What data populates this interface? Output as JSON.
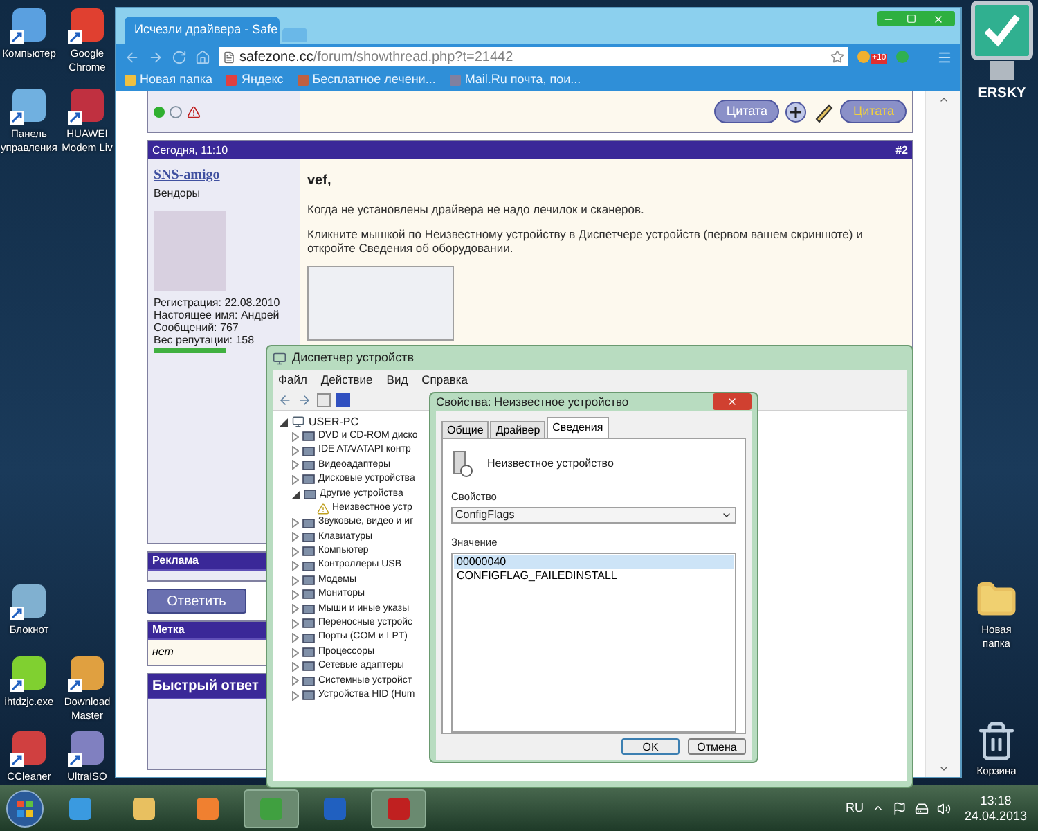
{
  "desktop_left": [
    {
      "label": "Компьютер"
    },
    {
      "label": "Google Chrome"
    },
    {
      "label": "Панель управления"
    },
    {
      "label": "HUAWEI Modem Liv"
    },
    {
      "label": "Блокнот"
    },
    {
      "label": "ihtdzjc.exe"
    },
    {
      "label": "Download Master"
    },
    {
      "label": "CCleaner"
    },
    {
      "label": "UltraISO"
    }
  ],
  "desktop_right": [
    {
      "label": "Новая папка"
    },
    {
      "label": "Корзина"
    }
  ],
  "gadget": {
    "label": "ERSKY"
  },
  "browser": {
    "tab_title": "Исчезли драйвера - Safe",
    "url_host": "safezone.cc",
    "url_path": "/forum/showthread.php?t=21442",
    "extension_badge": "+10",
    "bookmarks": [
      "Новая папка",
      "Яндекс",
      "Бесплатное лечени...",
      "Mail.Ru почта, пои..."
    ]
  },
  "forum": {
    "quote_buttons": [
      "Цитата",
      "Цитата"
    ],
    "post": {
      "date": "Сегодня, 11:10",
      "number": "#2",
      "user": "SNS-amigo",
      "role": "Вендоры",
      "stats": [
        "Регистрация: 22.08.2010",
        "Настоящее имя: Андрей",
        "Сообщений: 767",
        "Вес репутации: 158"
      ],
      "greeting": "vef,",
      "paragraphs": [
        "Когда не установлены драйвера не надо лечилок и сканеров.",
        "Кликните мышкой по Неизвестному устройству в Диспетчере устройств (первом вашем скриншоте) и откройте Сведения об оборудовании."
      ]
    },
    "ads_title": "Реклама",
    "reply_button": "Ответить",
    "tag_title": "Метка",
    "tag_value": "нет",
    "quick_reply_title": "Быстрый ответ"
  },
  "device_manager": {
    "title": "Диспетчер устройств",
    "menu": [
      "Файл",
      "Действие",
      "Вид",
      "Справка"
    ],
    "tree": {
      "label": "USER-PC",
      "expanded": true,
      "children": [
        {
          "label": "DVD и CD-ROM диско",
          "expanded": false
        },
        {
          "label": "IDE ATA/ATAPI контр",
          "expanded": false
        },
        {
          "label": "Видеоадаптеры",
          "expanded": false
        },
        {
          "label": "Дисковые устройства",
          "expanded": false
        },
        {
          "label": "Другие устройства",
          "expanded": true,
          "children": [
            {
              "label": "Неизвестное устр"
            }
          ]
        },
        {
          "label": "Звуковые, видео и иг",
          "expanded": false
        },
        {
          "label": "Клавиатуры",
          "expanded": false
        },
        {
          "label": "Компьютер",
          "expanded": false
        },
        {
          "label": "Контроллеры USB",
          "expanded": false
        },
        {
          "label": "Модемы",
          "expanded": false
        },
        {
          "label": "Мониторы",
          "expanded": false
        },
        {
          "label": "Мыши и иные указы",
          "expanded": false
        },
        {
          "label": "Переносные устройс",
          "expanded": false
        },
        {
          "label": "Порты (COM и LPT)",
          "expanded": false
        },
        {
          "label": "Процессоры",
          "expanded": false
        },
        {
          "label": "Сетевые адаптеры",
          "expanded": false
        },
        {
          "label": "Системные устройст",
          "expanded": false
        },
        {
          "label": "Устройства HID (Hum",
          "expanded": false
        }
      ]
    }
  },
  "dialog": {
    "title": "Свойства: Неизвестное устройство",
    "tabs": [
      {
        "label": "Общие",
        "selected": false
      },
      {
        "label": "Драйвер",
        "selected": false
      },
      {
        "label": "Сведения",
        "selected": true
      }
    ],
    "device_name": "Неизвестное устройство",
    "property_label": "Свойство",
    "property_value": "ConfigFlags",
    "value_label": "Значение",
    "values": [
      {
        "text": "00000040",
        "selected": true
      },
      {
        "text": "CONFIGFLAG_FAILEDINSTALL",
        "selected": false
      }
    ],
    "buttons": [
      "OK",
      "Отмена"
    ]
  },
  "taskbar": {
    "items": [
      {
        "kind": "ie",
        "active": false
      },
      {
        "kind": "explorer",
        "active": false
      },
      {
        "kind": "player",
        "active": false
      },
      {
        "kind": "chrome",
        "active": true
      },
      {
        "kind": "maxthon",
        "active": false
      },
      {
        "kind": "toolbox",
        "active": true
      }
    ],
    "language": "RU",
    "time": "13:18",
    "date": "24.04.2013"
  }
}
